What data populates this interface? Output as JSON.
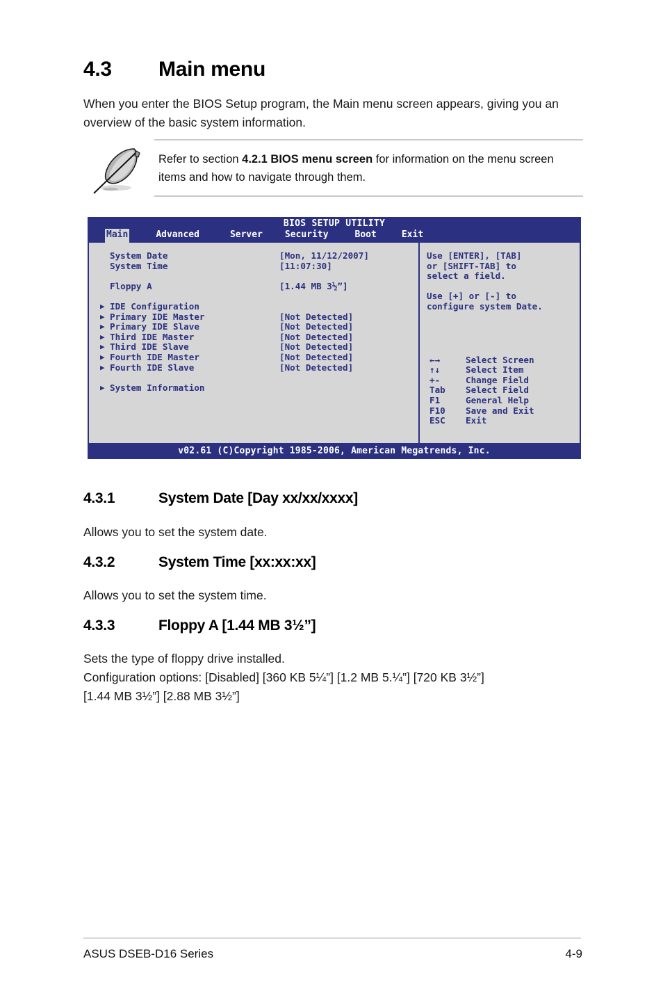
{
  "section": {
    "number": "4.3",
    "title": "Main menu",
    "intro": "When you enter the BIOS Setup program, the Main menu screen appears, giving you an overview of the basic system information."
  },
  "note": {
    "icon": "quill-pen-icon",
    "text_before": "Refer to section ",
    "text_bold": "4.2.1 BIOS menu screen",
    "text_after": " for information on the menu screen items and how to navigate through them."
  },
  "bios": {
    "title": "BIOS SETUP UTILITY",
    "tabs": [
      {
        "label": "Main",
        "active": true
      },
      {
        "label": "Advanced",
        "active": false
      },
      {
        "label": "Server",
        "active": false
      },
      {
        "label": "Security",
        "active": false
      },
      {
        "label": "Boot",
        "active": false
      },
      {
        "label": "Exit",
        "active": false
      }
    ],
    "items": [
      {
        "arrow": "",
        "label": "System Date",
        "value": "[Mon, 11/12/2007]"
      },
      {
        "arrow": "",
        "label": "System Time",
        "value": "[11:07:30]"
      },
      {
        "arrow": "",
        "label": "",
        "value": ""
      },
      {
        "arrow": "",
        "label": "Floppy A",
        "value": "[1.44 MB 3½”]"
      },
      {
        "arrow": "",
        "label": "",
        "value": ""
      },
      {
        "arrow": "▶",
        "label": "IDE Configuration",
        "value": ""
      },
      {
        "arrow": "▶",
        "label": "Primary IDE Master",
        "value": "[Not Detected]"
      },
      {
        "arrow": "▶",
        "label": "Primary IDE Slave",
        "value": "[Not Detected]"
      },
      {
        "arrow": "▶",
        "label": "Third IDE Master",
        "value": "[Not Detected]"
      },
      {
        "arrow": "▶",
        "label": "Third IDE Slave",
        "value": "[Not Detected]"
      },
      {
        "arrow": "▶",
        "label": "Fourth IDE Master",
        "value": "[Not Detected]"
      },
      {
        "arrow": "▶",
        "label": "Fourth IDE Slave",
        "value": "[Not Detected]"
      },
      {
        "arrow": "",
        "label": "",
        "value": ""
      },
      {
        "arrow": "▶",
        "label": "System Information",
        "value": ""
      }
    ],
    "help": {
      "para1": "Use [ENTER], [TAB]\nor [SHIFT-TAB] to\nselect a field.",
      "para2": "Use [+] or [-] to\nconfigure system Date."
    },
    "keys": [
      {
        "key": "←→",
        "desc": "Select Screen"
      },
      {
        "key": "↑↓",
        "desc": "Select Item"
      },
      {
        "key": "+-",
        "desc": "Change Field"
      },
      {
        "key": "Tab",
        "desc": "Select Field"
      },
      {
        "key": "F1",
        "desc": "General Help"
      },
      {
        "key": "F10",
        "desc": "Save and Exit"
      },
      {
        "key": "ESC",
        "desc": "Exit"
      }
    ],
    "footer": "v02.61 (C)Copyright 1985-2006, American Megatrends, Inc.",
    "colors": {
      "chrome_blue": "#2b3180",
      "panel_gray": "#d6d6d6",
      "text_blue": "#2b3180"
    }
  },
  "subsections": [
    {
      "number": "4.3.1",
      "title": "System Date [Day xx/xx/xxxx]",
      "body": "Allows you to set the system date."
    },
    {
      "number": "4.3.2",
      "title": "System Time [xx:xx:xx]",
      "body": "Allows you to set the system time."
    },
    {
      "number": "4.3.3",
      "title": "Floppy A [1.44 MB 3½”]",
      "body_line1": "Sets the type of floppy drive installed.",
      "body_line2": "Configuration options: [Disabled] [360 KB 5¼”] [1.2 MB 5.¼”] [720 KB 3½”]",
      "body_line3": "[1.44 MB 3½”] [2.88 MB 3½”]"
    }
  ],
  "page_footer": {
    "left": "ASUS DSEB-D16 Series",
    "right": "4-9"
  }
}
